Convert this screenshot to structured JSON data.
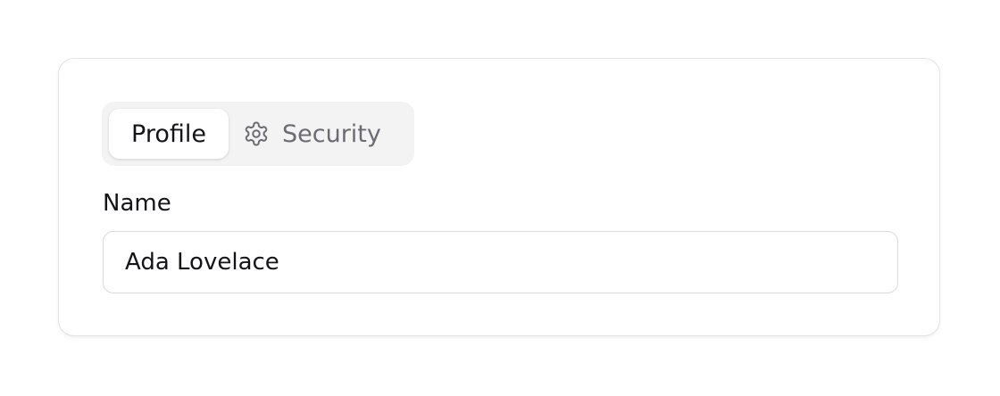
{
  "tabs": {
    "profile_label": "Profile",
    "security_label": "Security",
    "security_icon": "gear-icon",
    "active": "Profile"
  },
  "form": {
    "name_label": "Name",
    "name_value": "Ada Lovelace"
  }
}
